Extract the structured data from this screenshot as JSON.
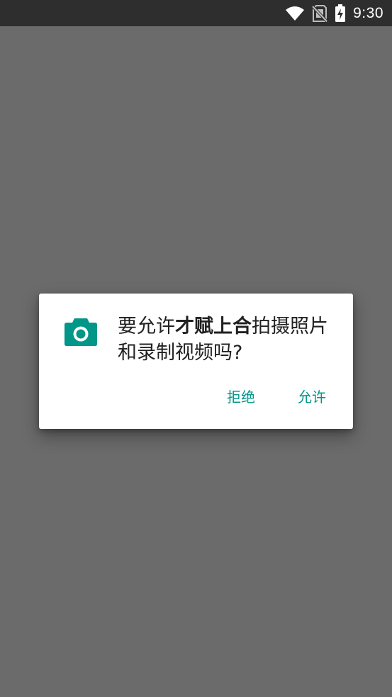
{
  "status_bar": {
    "time": "9:30",
    "icons": [
      "wifi-icon",
      "no-sim-icon",
      "battery-charging-icon"
    ]
  },
  "dialog": {
    "icon": "camera-icon",
    "message_prefix": "要允许",
    "app_name": "才赋上合",
    "message_suffix": "拍摄照片和录制视频吗?",
    "deny_label": "拒绝",
    "allow_label": "允许"
  },
  "colors": {
    "status_bar_bg": "#2e2e2e",
    "scrim": "#6b6b6b",
    "accent": "#009688",
    "dialog_bg": "#ffffff",
    "text": "#212121"
  }
}
